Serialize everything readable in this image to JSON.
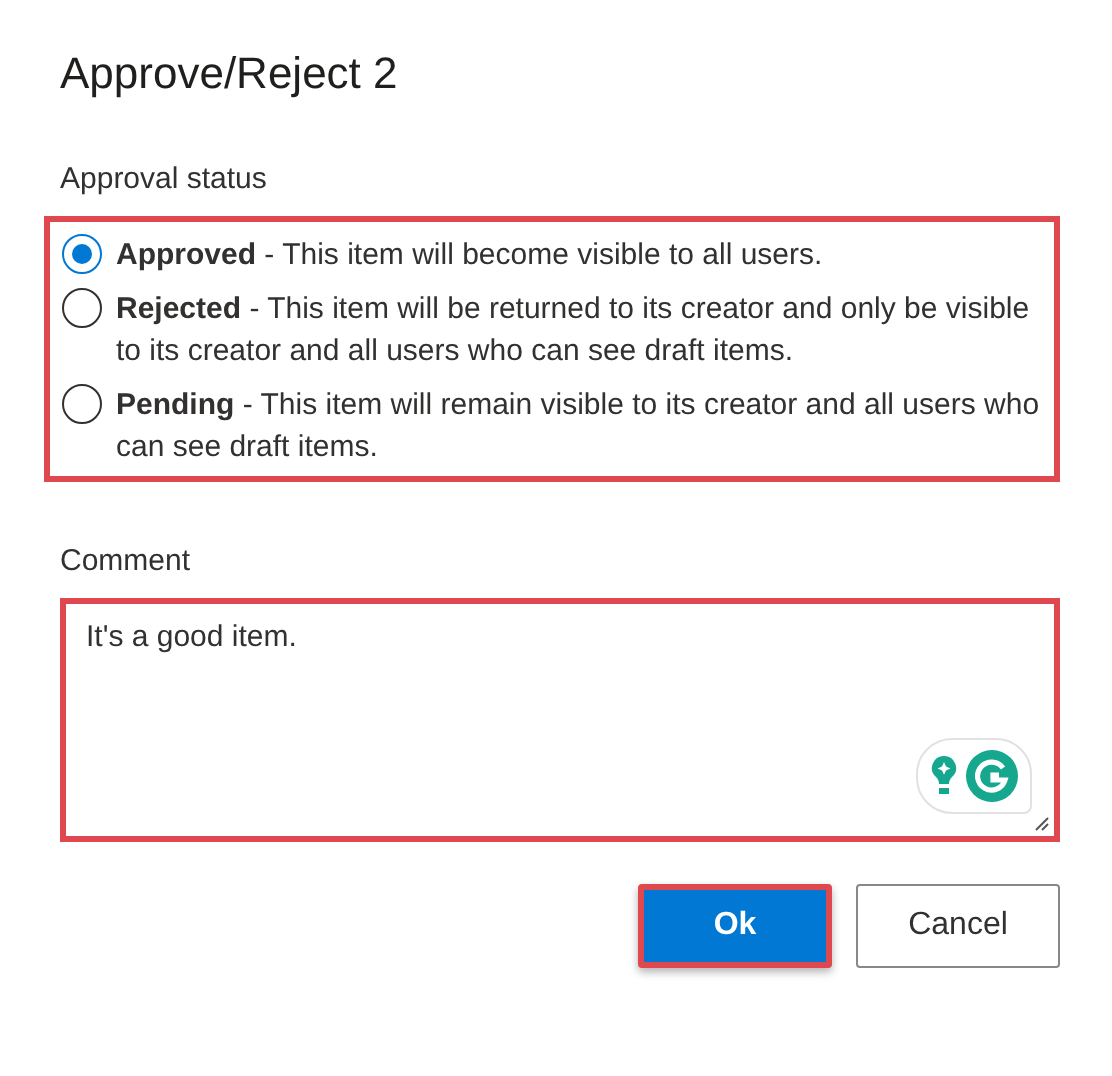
{
  "dialog": {
    "title": "Approve/Reject 2"
  },
  "approval_status": {
    "label": "Approval status",
    "options": [
      {
        "text": "**Approved** - This item will become visible to all users.",
        "selected": true
      },
      {
        "text": "**Rejected** - This item will be returned to its creator and only be visible to its creator and all users who can see draft items.",
        "selected": false
      },
      {
        "text": "**Pending** - This item will remain visible to its creator and all users who can see draft items.",
        "selected": false
      }
    ]
  },
  "comment": {
    "label": "Comment",
    "value": "It's a good item."
  },
  "buttons": [
    {
      "label": "Ok",
      "kind": "primary"
    },
    {
      "label": "Cancel",
      "kind": "secondary"
    }
  ]
}
